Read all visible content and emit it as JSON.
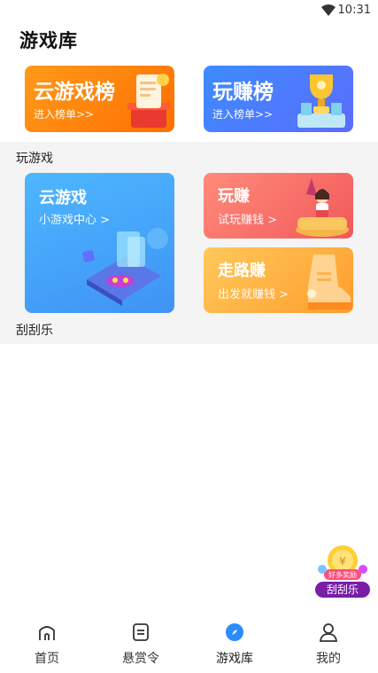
{
  "status": {
    "time": "10:31"
  },
  "header": {
    "title": "游戏库"
  },
  "rank_cards": [
    {
      "title": "云游戏榜",
      "subtitle": "进入榜单>>"
    },
    {
      "title": "玩赚榜",
      "subtitle": "进入榜单>>"
    }
  ],
  "section_play": {
    "label": "玩游戏",
    "cloud_game": {
      "title": "云游戏",
      "subtitle": "小游戏中心 >"
    },
    "play_earn": {
      "title": "玩赚",
      "subtitle": "试玩赚钱 >"
    },
    "walk_earn": {
      "title": "走路赚",
      "subtitle": "出发就赚钱 >"
    }
  },
  "section_scratch": {
    "label": "刮刮乐"
  },
  "floating_badge": {
    "label": "刮刮乐",
    "banner": "好多奖励"
  },
  "tabbar": {
    "tabs": [
      {
        "label": "首页",
        "icon": "home-icon"
      },
      {
        "label": "悬赏令",
        "icon": "task-icon"
      },
      {
        "label": "游戏库",
        "icon": "compass-icon",
        "active": true
      },
      {
        "label": "我的",
        "icon": "person-icon"
      }
    ],
    "active_color": "#2a8cff"
  },
  "colors": {
    "cloud_rank": "#ff7d00",
    "earn_rank": "#4a7dff",
    "cloud_game": "#42a8fb",
    "play_earn": "#f56a63",
    "walk_earn": "#ffb040"
  }
}
